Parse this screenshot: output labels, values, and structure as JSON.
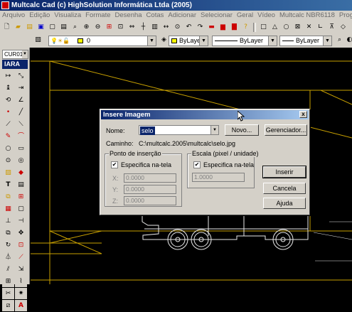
{
  "window": {
    "title": "Multcalc Cad (c) HighSolution Informática Ltda (2005)"
  },
  "menu": [
    "Arquivo",
    "Edição",
    "Visualiza",
    "Formate",
    "Desenha",
    "Cotas",
    "Adicionar",
    "Selecionar",
    "Geral",
    "Vídeo",
    "Multcalc NBR6118",
    "Programas Auxiliares"
  ],
  "toolbar2": {
    "layer": "0",
    "color": "ByLayer",
    "linetype": "ByLayer",
    "lineweight": "ByLayer"
  },
  "leftbar": {
    "cursor_combo": "CUR01",
    "panel_title": "IARA"
  },
  "dialog": {
    "title": "Insere Imagem",
    "close_label": "x",
    "name_label": "Nome:",
    "name_value": "selo",
    "novo_button": "Novo...",
    "gerenciador_button": "Gerenciador...",
    "caminho_label": "Caminho:",
    "caminho_value": "C:\\multcalc.2005\\multcalc\\selo.jpg",
    "insercao": {
      "title": "Ponto de inserção",
      "checkbox_label": "Especifica na-tela",
      "checked": true,
      "x_label": "X:",
      "x_value": "0.0000",
      "y_label": "Y:",
      "y_value": "0.0000",
      "z_label": "Z:",
      "z_value": "0.0000"
    },
    "escala": {
      "title": "Escala (pixel / unidade)",
      "checkbox_label": "Especifica na-tela",
      "checked": true,
      "value": "1.0000"
    },
    "inserir_button": "Inserir",
    "cancela_button": "Cancela",
    "ajuda_button": "Ajuda"
  },
  "colors": {
    "title_bar": "#0a246a",
    "panel": "#d4d0c8",
    "drawing_lines": "#c8a000",
    "canvas": "#000000"
  }
}
